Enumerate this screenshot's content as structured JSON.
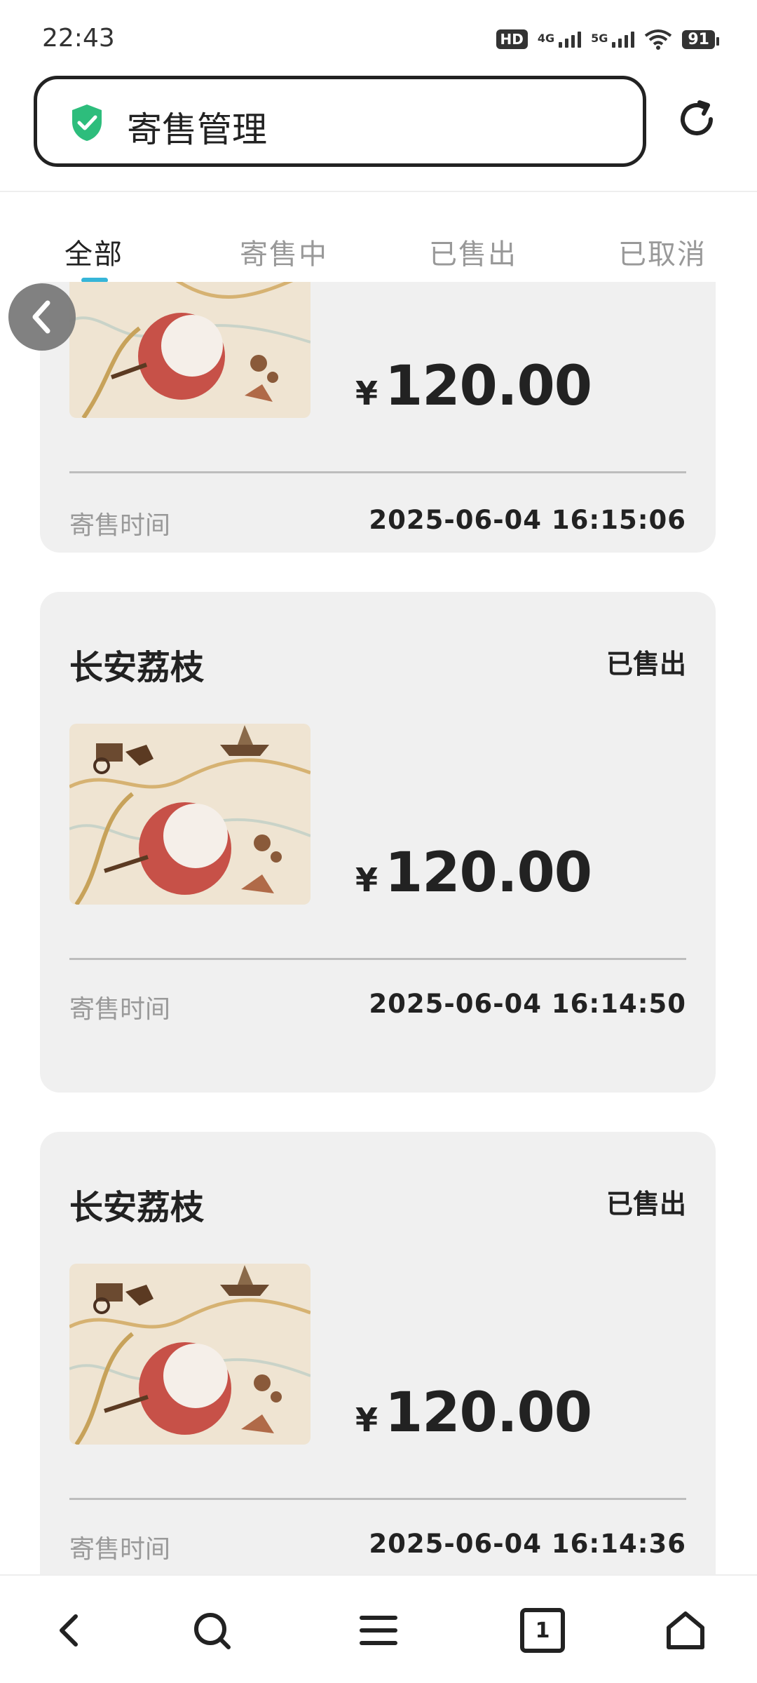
{
  "status_bar": {
    "time": "22:43",
    "hd_badge": "HD",
    "network_4g": "4G",
    "network_5g": "5G",
    "battery": "91"
  },
  "header": {
    "title": "寄售管理",
    "shield_color": "#2dbd7c"
  },
  "tabs": [
    {
      "label": "全部",
      "active": true
    },
    {
      "label": "寄售中",
      "active": false
    },
    {
      "label": "已售出",
      "active": false
    },
    {
      "label": "已取消",
      "active": false
    }
  ],
  "accent_color": "#36b5d8",
  "orders": [
    {
      "title": "",
      "status": "",
      "currency": "¥",
      "price": "120.00",
      "time_label": "寄售时间",
      "time_value": "2025-06-04 16:15:06"
    },
    {
      "title": "长安荔枝",
      "status": "已售出",
      "currency": "¥",
      "price": "120.00",
      "time_label": "寄售时间",
      "time_value": "2025-06-04 16:14:50"
    },
    {
      "title": "长安荔枝",
      "status": "已售出",
      "currency": "¥",
      "price": "120.00",
      "time_label": "寄售时间",
      "time_value": "2025-06-04 16:14:36"
    }
  ],
  "bottom_nav": {
    "tab_count": "1"
  }
}
